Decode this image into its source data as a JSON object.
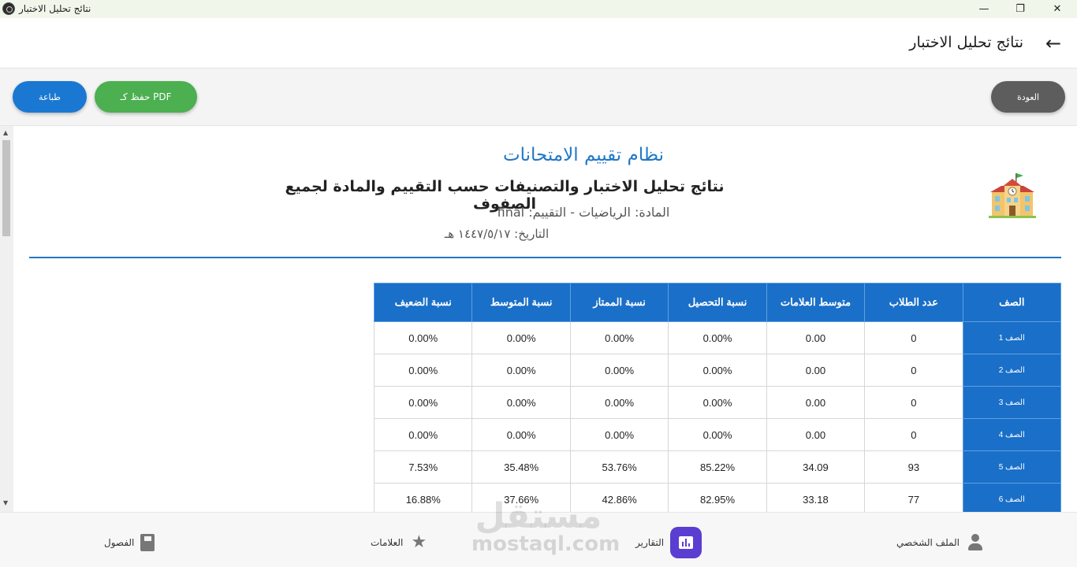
{
  "window": {
    "title": "نتائج تحليل الاختبار",
    "controls": {
      "minimize": "—",
      "restore": "❐",
      "close": "✕"
    }
  },
  "appbar": {
    "title": "نتائج تحليل الاختبار",
    "back_icon": "←"
  },
  "actions": {
    "print_label": "طباعة",
    "pdf_label": "حفظ كـ PDF",
    "back_label": "العودة"
  },
  "report": {
    "system_title": "نظام تقييم الامتحانات",
    "subtitle": "نتائج تحليل الاختبار والتصنيفات حسب التقييم والمادة لجميع الصفوف",
    "meta": "المادة: الرياضيات - التقييم: final",
    "date": "التاريخ: ١٤٤٧/٥/١٧ هـ",
    "school_icon": "school-icon"
  },
  "table": {
    "headers": [
      "الصف",
      "عدد الطلاب",
      "متوسط العلامات",
      "نسبة التحصيل",
      "نسبة الممتاز",
      "نسبة المتوسط",
      "نسبة الضعيف"
    ],
    "rows": [
      [
        "الصف 1",
        "0",
        "0.00",
        "0.00%",
        "0.00%",
        "0.00%",
        "0.00%"
      ],
      [
        "الصف 2",
        "0",
        "0.00",
        "0.00%",
        "0.00%",
        "0.00%",
        "0.00%"
      ],
      [
        "الصف 3",
        "0",
        "0.00",
        "0.00%",
        "0.00%",
        "0.00%",
        "0.00%"
      ],
      [
        "الصف 4",
        "0",
        "0.00",
        "0.00%",
        "0.00%",
        "0.00%",
        "0.00%"
      ],
      [
        "الصف 5",
        "93",
        "34.09",
        "85.22%",
        "53.76%",
        "35.48%",
        "7.53%"
      ],
      [
        "الصف 6",
        "77",
        "33.18",
        "82.95%",
        "42.86%",
        "37.66%",
        "16.88%"
      ]
    ]
  },
  "bottom_nav": {
    "profile": "الملف الشخصي",
    "reports": "التقارير",
    "grades": "العلامات",
    "classes": "الفصول"
  },
  "watermark": {
    "arabic": "مستقل",
    "latin": "mostaql.com"
  },
  "colors": {
    "accent": "#1a6fc8",
    "pdf": "#4caf50",
    "back": "#5d5d5d",
    "nav_active": "#5a3ed1"
  }
}
